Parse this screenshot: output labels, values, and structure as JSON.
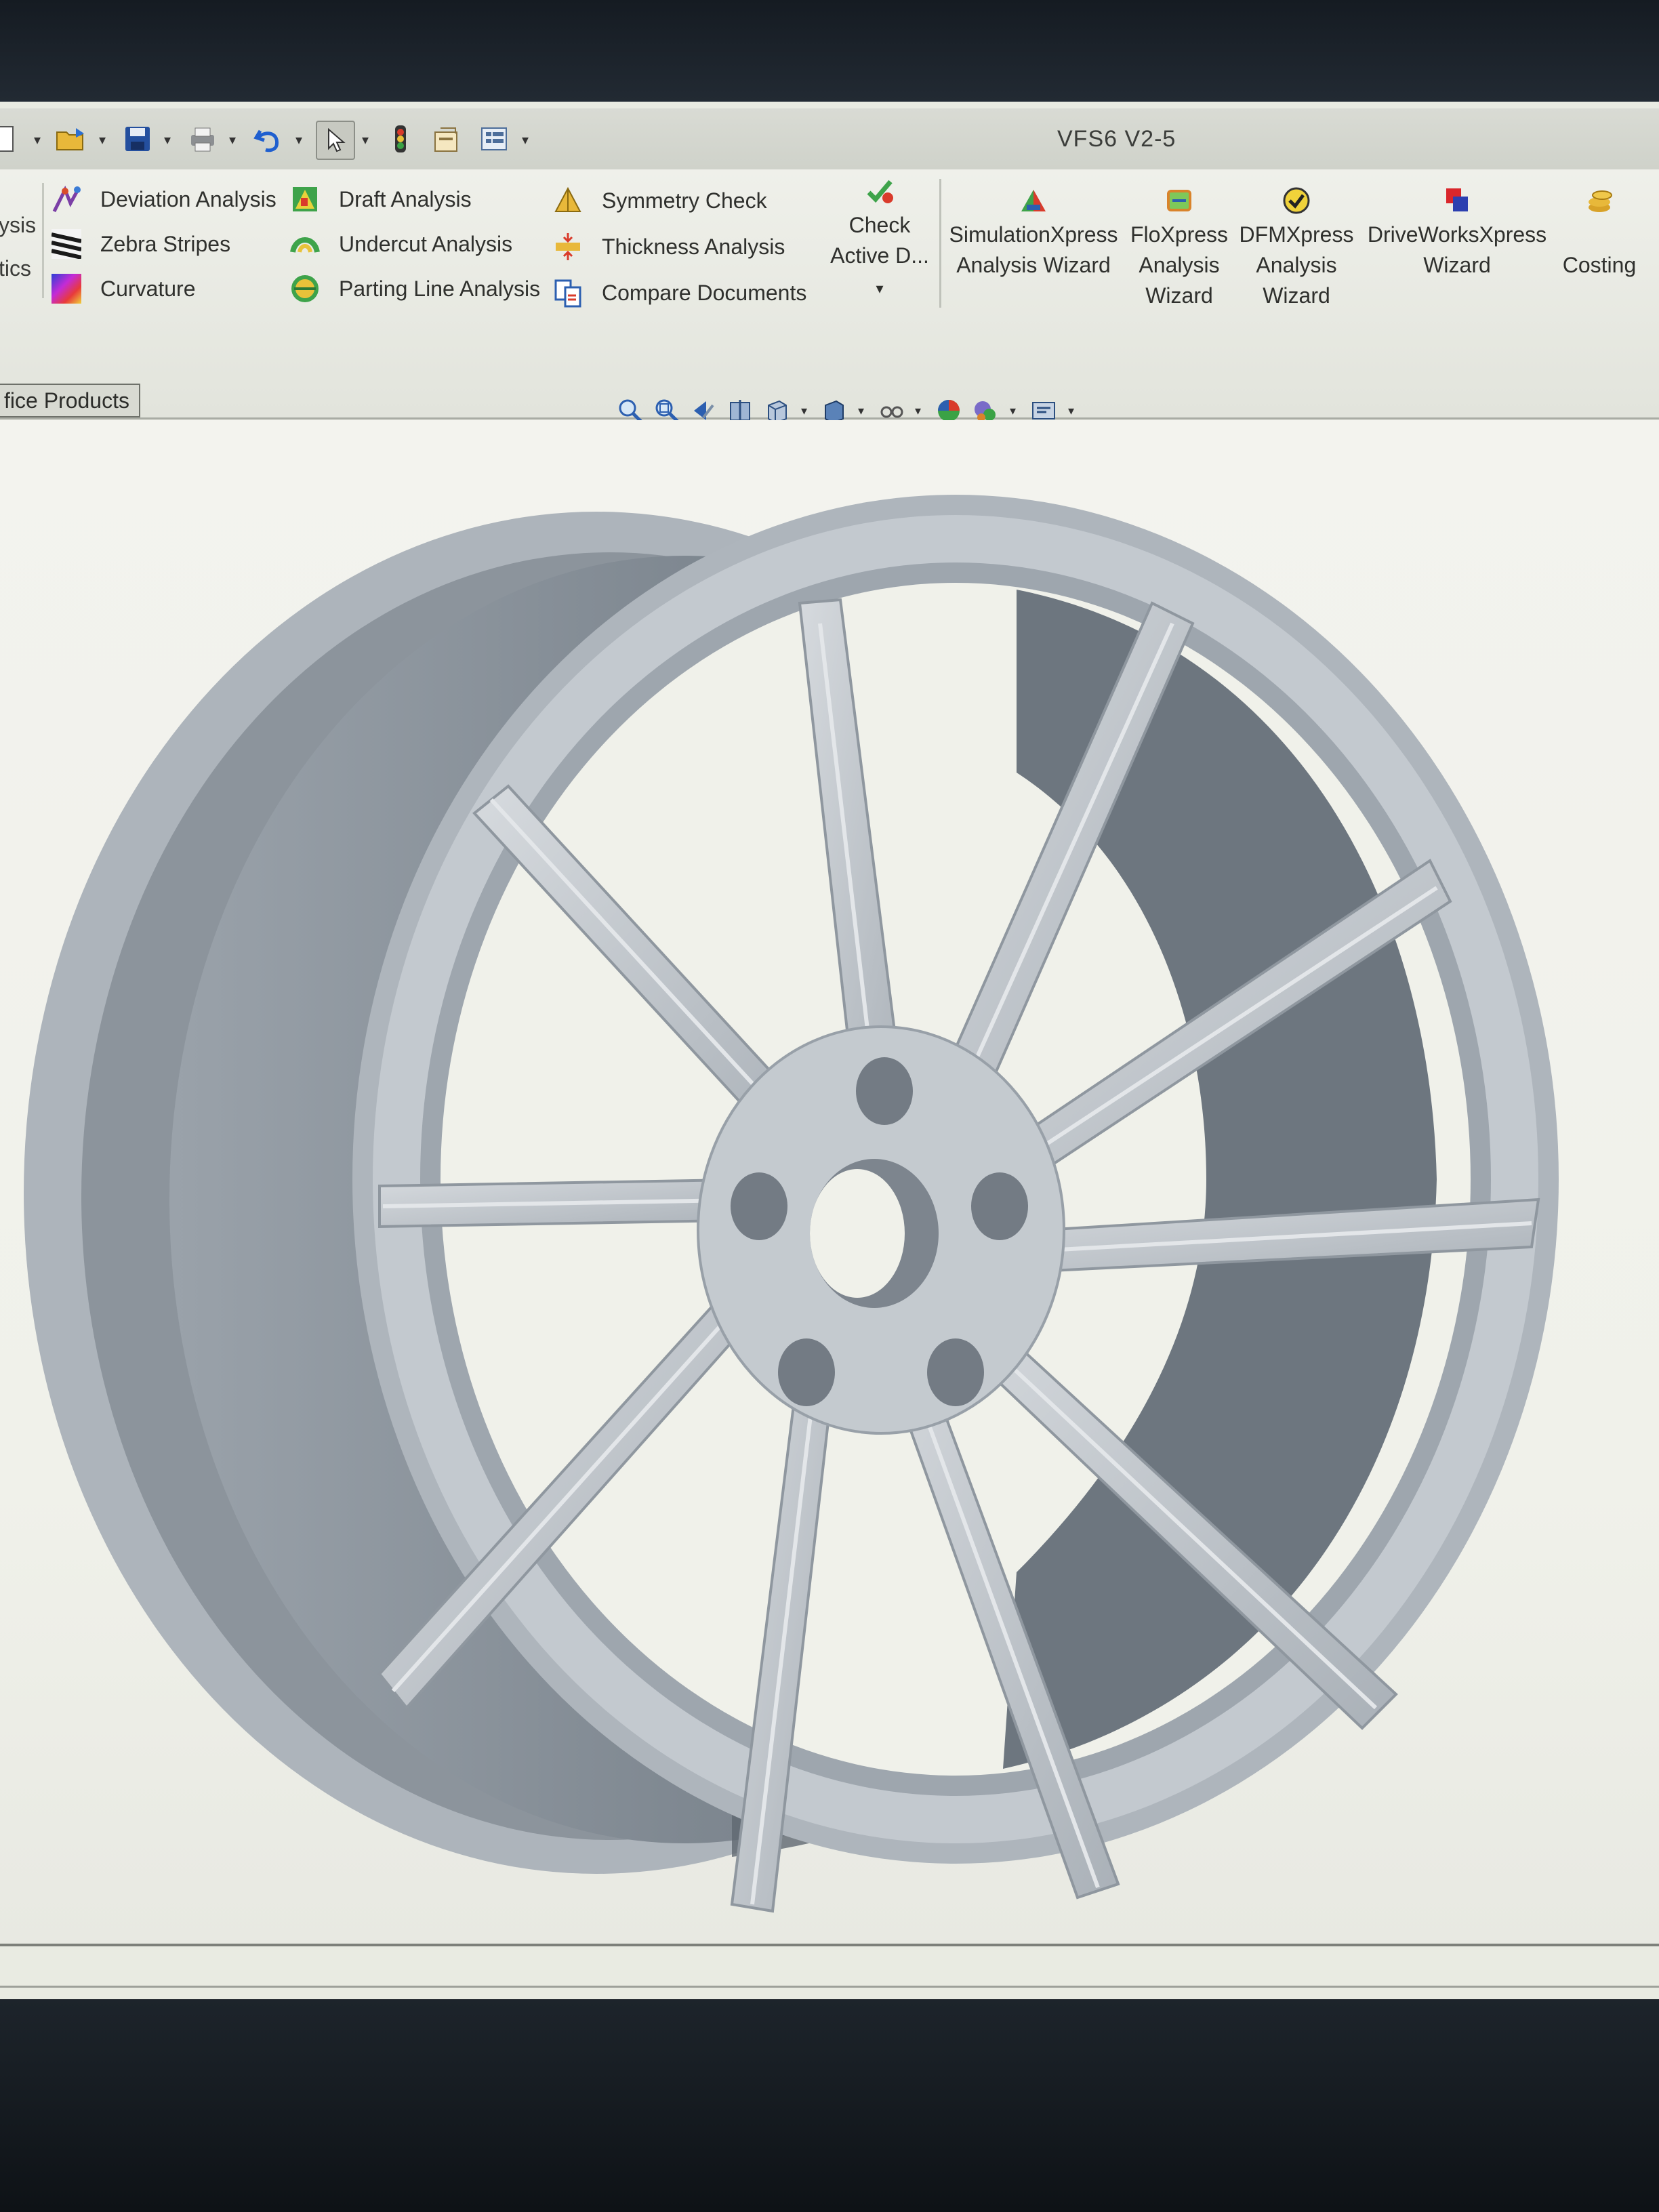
{
  "window": {
    "title": "VFS6 V2-5"
  },
  "quick_access": {
    "icons": [
      "new-icon",
      "open-icon",
      "save-icon",
      "print-icon",
      "undo-icon",
      "select-icon",
      "rebuild-icon",
      "file-properties-icon",
      "options-icon"
    ]
  },
  "ribbon": {
    "partial_left": [
      "ysis",
      "tics"
    ],
    "col1": [
      "Deviation Analysis",
      "Zebra Stripes",
      "Curvature"
    ],
    "col2": [
      "Draft Analysis",
      "Undercut Analysis",
      "Parting Line Analysis"
    ],
    "col3": [
      "Symmetry Check",
      "Thickness Analysis",
      "Compare Documents"
    ],
    "check_active": [
      "Check",
      "Active D..."
    ],
    "simulation": [
      "SimulationXpress",
      "Analysis Wizard"
    ],
    "floxpress": [
      "FloXpress",
      "Analysis",
      "Wizard"
    ],
    "dfmxpress": [
      "DFMXpress",
      "Analysis",
      "Wizard"
    ],
    "driveworks": [
      "DriveWorksXpress",
      "Wizard"
    ],
    "costing": "Costing"
  },
  "tabs": {
    "office_products": "fice Products"
  },
  "view_toolbar": {
    "icons": [
      "zoom-to-fit-icon",
      "zoom-to-area-icon",
      "previous-view-icon",
      "section-view-icon",
      "view-orientation-icon",
      "display-style-icon",
      "hide-show-items-icon",
      "edit-appearance-icon",
      "apply-scene-icon",
      "view-settings-icon"
    ]
  },
  "colors": {
    "ribbon_bg": "#eceee6",
    "graphics_bg": "#f0f1ea",
    "taskbar": "#3a9bc2",
    "wheel_face": "#b9bfc5",
    "wheel_shadow": "#77808a"
  }
}
